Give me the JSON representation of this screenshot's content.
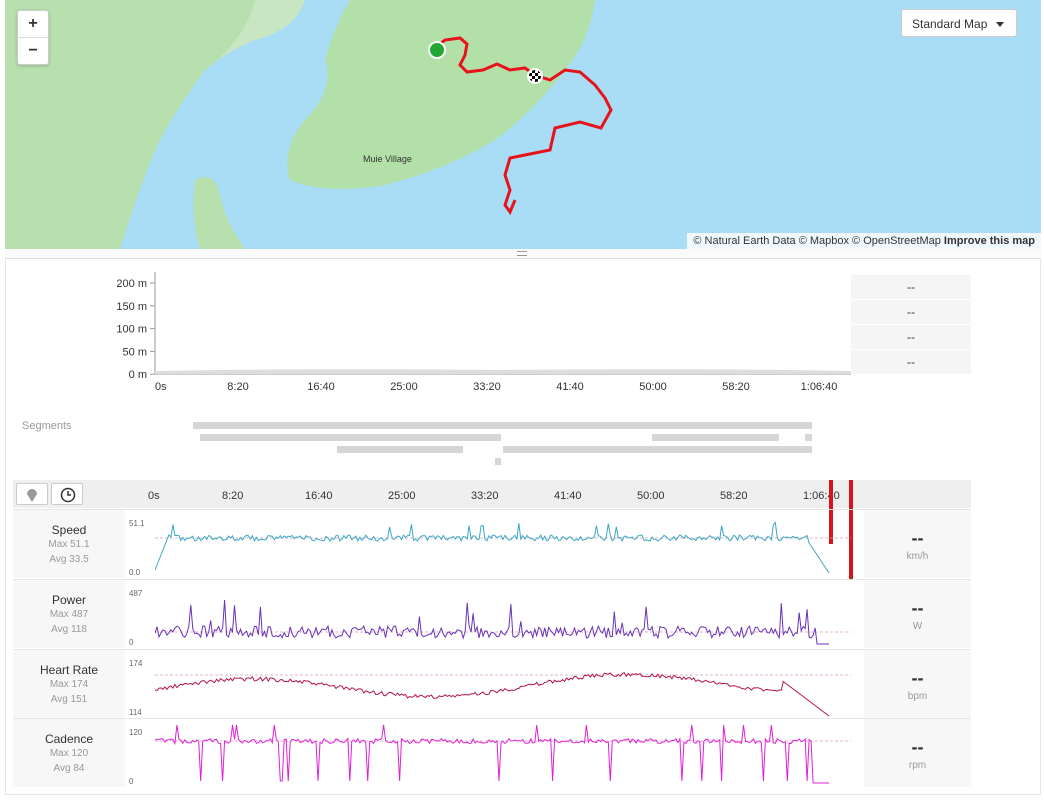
{
  "map": {
    "zoom_in": "+",
    "zoom_out": "−",
    "style_label": "Standard Map",
    "village": "Muie Village",
    "attribution": "© Natural Earth Data © Mapbox © OpenStreetMap",
    "improve": "Improve this map",
    "route_color": "#e8121b",
    "start_color": "#22a832"
  },
  "elevation": {
    "y_ticks": [
      "200 m",
      "150 m",
      "100 m",
      "50 m",
      "0 m"
    ],
    "x_ticks": [
      "0s",
      "8:20",
      "16:40",
      "25:00",
      "33:20",
      "41:40",
      "50:00",
      "58:20",
      "1:06:40"
    ],
    "side_values": [
      "--",
      "--",
      "--",
      "--"
    ]
  },
  "segments": {
    "label": "Segments"
  },
  "timeline": {
    "x_ticks": [
      "0s",
      "8:20",
      "16:40",
      "25:00",
      "33:20",
      "41:40",
      "50:00",
      "58:20",
      "1:06:40"
    ],
    "marker_color": "#d7141c"
  },
  "metrics": [
    {
      "name": "Speed",
      "max": "Max 51.1",
      "avg": "Avg 33.5",
      "ymax": "51.1",
      "ymin": "0.0",
      "value": "--",
      "unit": "km/h",
      "color": "#3aa7c9"
    },
    {
      "name": "Power",
      "max": "Max 487",
      "avg": "Avg 118",
      "ymax": "487",
      "ymin": "0",
      "value": "--",
      "unit": "W",
      "color": "#6a32b8"
    },
    {
      "name": "Heart Rate",
      "max": "Max 174",
      "avg": "Avg 151",
      "ymax": "174",
      "ymin": "114",
      "value": "--",
      "unit": "bpm",
      "color": "#b41448"
    },
    {
      "name": "Cadence",
      "max": "Max 120",
      "avg": "Avg 84",
      "ymax": "120",
      "ymin": "0",
      "value": "--",
      "unit": "rpm",
      "color": "#e020d8"
    }
  ]
}
